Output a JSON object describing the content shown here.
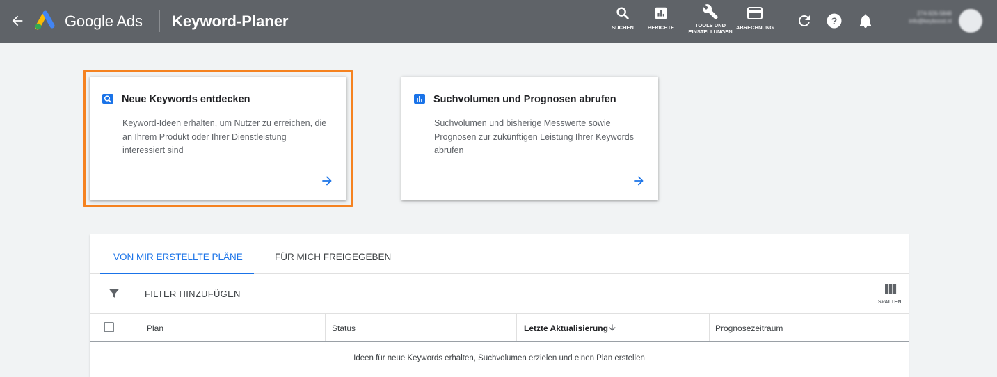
{
  "header": {
    "brand": "Google Ads",
    "page_title": "Keyword-Planer",
    "nav": {
      "search": "SUCHEN",
      "reports": "BERICHTE",
      "tools_line1": "TOOLS UND",
      "tools_line2": "EINSTELLUNGEN",
      "billing": "ABRECHNUNG"
    },
    "account": {
      "id": "274-926-5848",
      "email": "info@keyboost.nl"
    }
  },
  "cards": [
    {
      "title": "Neue Keywords entdecken",
      "desc_lines": [
        "Keyword-Ideen erhalten, um Nutzer zu erreichen, die",
        "an Ihrem Produkt oder Ihrer Dienstleistung",
        "interessiert sind"
      ],
      "icon": "search-icon",
      "highlighted": true
    },
    {
      "title": "Suchvolumen und Prognosen abrufen",
      "desc_lines": [
        "Suchvolumen und bisherige Messwerte sowie",
        "Prognosen zur zukünftigen Leistung Ihrer Keywords",
        "abrufen"
      ],
      "icon": "bar-chart-icon",
      "highlighted": false
    }
  ],
  "plans": {
    "tabs": [
      "VON MIR ERSTELLTE PLÄNE",
      "FÜR MICH FREIGEGEBEN"
    ],
    "active_tab": 0,
    "filter_label": "FILTER HINZUFÜGEN",
    "columns_label": "SPALTEN",
    "headers": [
      "Plan",
      "Status",
      "Letzte Aktualisierung",
      "Prognosezeitraum"
    ],
    "empty_message": "Ideen für neue Keywords erhalten, Suchvolumen erzielen und einen Plan erstellen"
  },
  "colors": {
    "header_bg": "#5f6368",
    "accent": "#1a73e8",
    "highlight": "#f58220"
  }
}
